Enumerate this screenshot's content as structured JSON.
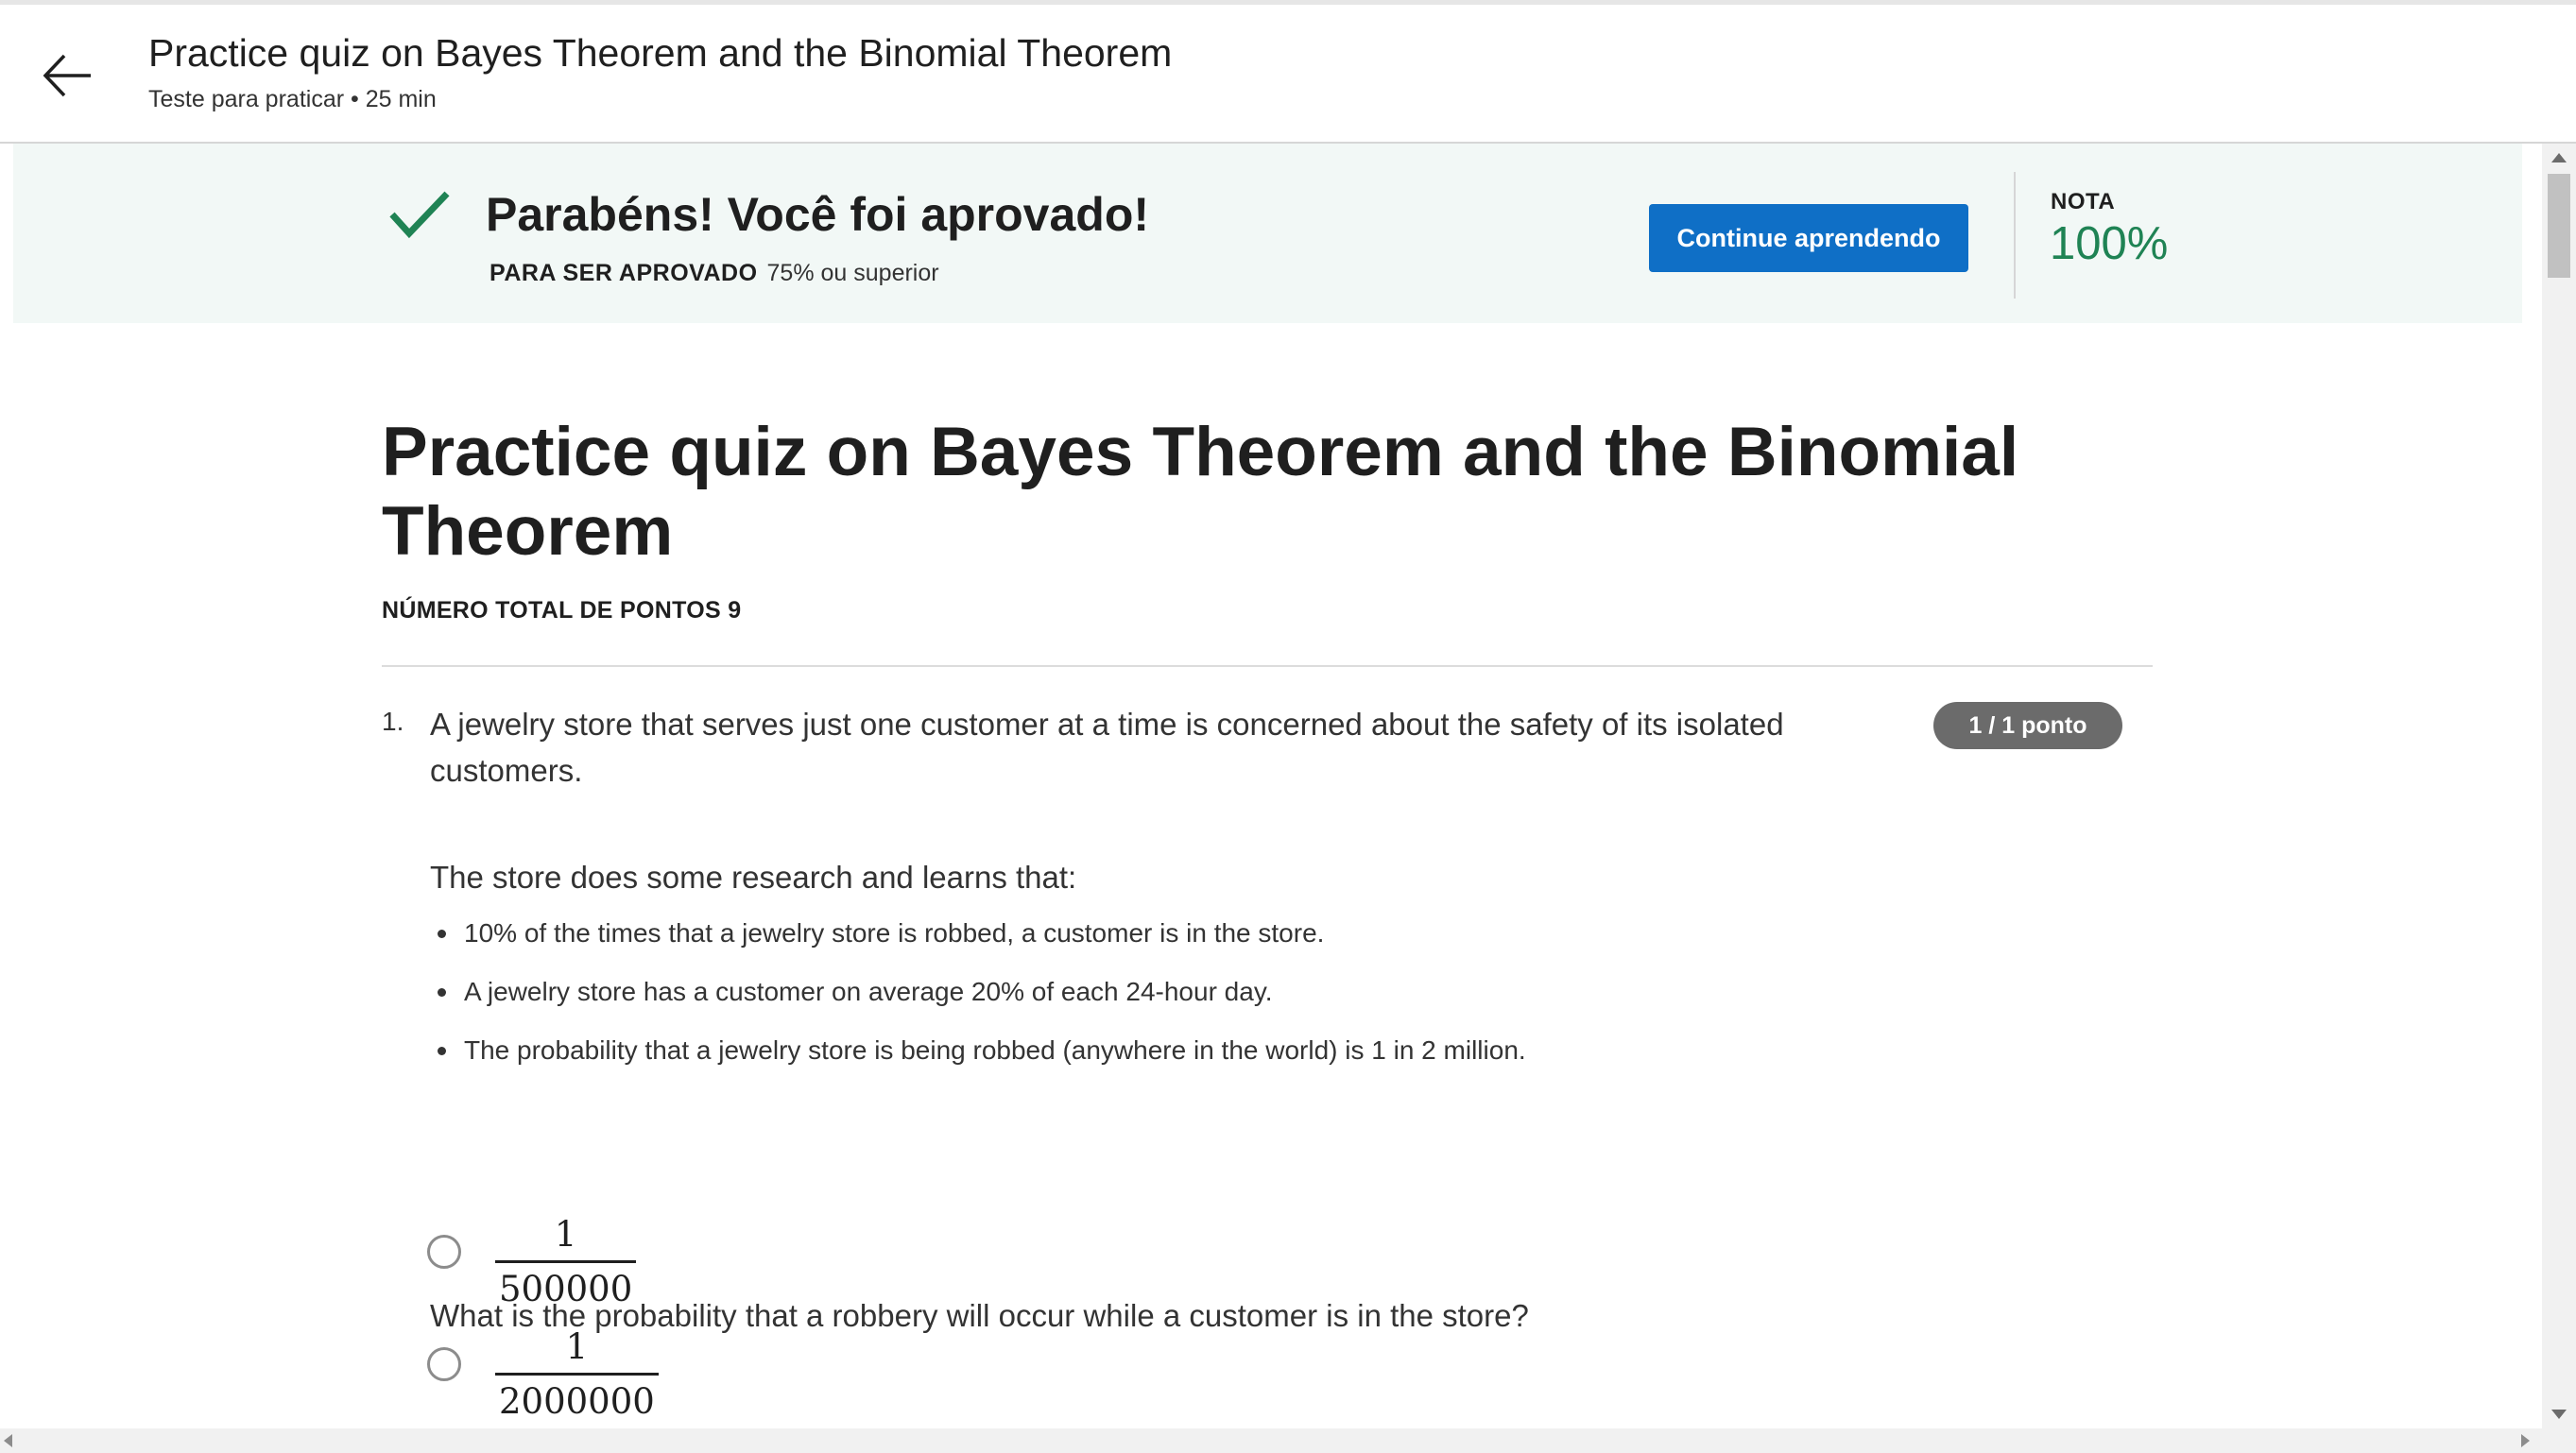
{
  "header": {
    "title": "Practice quiz on Bayes Theorem and the Binomial Theorem",
    "subtitle": "Teste para praticar • 25 min",
    "back_icon": "arrow-left-icon"
  },
  "banner": {
    "message": "Parabéns! Você foi aprovado!",
    "pass_label": "PARA SER APROVADO",
    "pass_value": "75% ou superior",
    "continue_label": "Continue aprendendo",
    "grade_label": "NOTA",
    "grade_value": "100%",
    "accent_color": "#1f8354",
    "button_color": "#0f6fc6",
    "check_icon": "checkmark-icon"
  },
  "quiz": {
    "title": "Practice quiz on Bayes Theorem and the Binomial Theorem",
    "total_points": "NÚMERO TOTAL DE PONTOS 9"
  },
  "question": {
    "number": "1.",
    "text": "A jewelry store that serves just one customer at a time is concerned about the safety of its isolated customers.",
    "score": "1 / 1 ponto",
    "intro": "The store does some research and learns that:",
    "bullets": [
      "10% of the times that a jewelry store is robbed, a customer is in the store.",
      "A jewelry store has a customer on average 20% of each 24-hour day.",
      "The probability that a jewelry store is being robbed (anywhere in the world) is 1 in 2 million."
    ],
    "ask": "What is the probability that a robbery will occur while a customer is in the store?",
    "options": [
      {
        "numerator": "1",
        "denominator": "500000"
      },
      {
        "numerator": "1",
        "denominator": "2000000"
      }
    ]
  }
}
